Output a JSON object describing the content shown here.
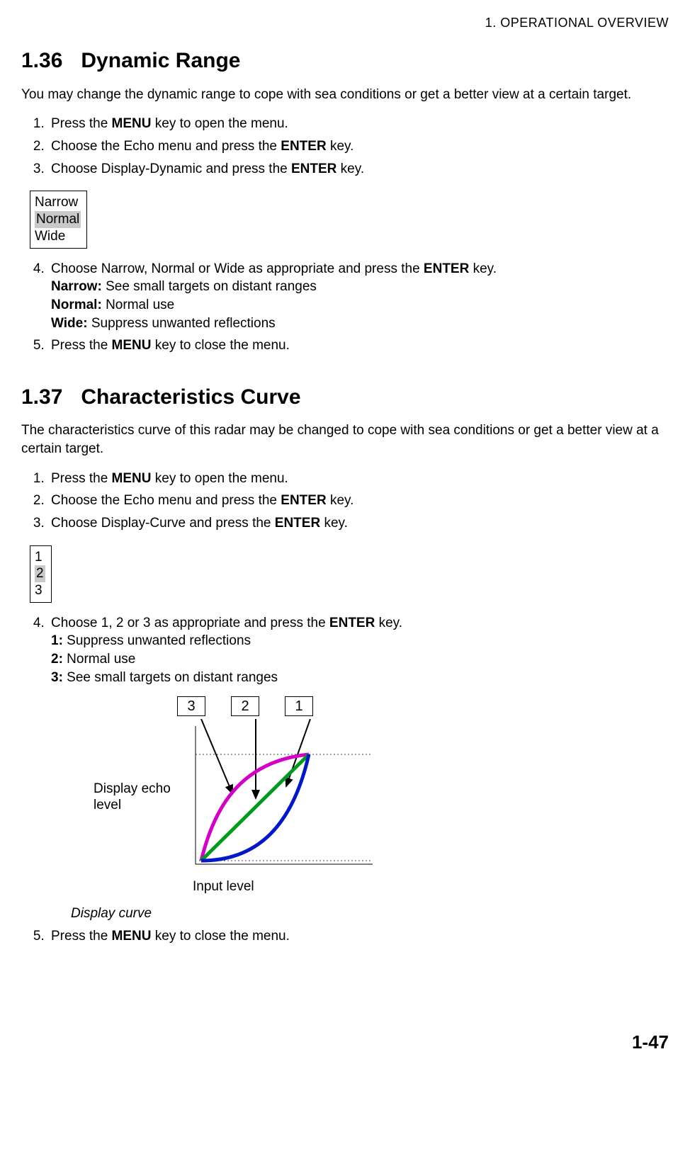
{
  "header": "1. OPERATIONAL OVERVIEW",
  "footer": "1-47",
  "section1": {
    "num": "1.36",
    "title": "Dynamic Range",
    "intro": "You may change the dynamic range to cope with sea conditions or get a better view at a certain target.",
    "steps": {
      "s1a": "Press the ",
      "s1b": "MENU",
      "s1c": " key to open the menu.",
      "s2a": "Choose the Echo menu and press the ",
      "s2b": "ENTER",
      "s2c": " key.",
      "s3a": "Choose Display-Dynamic and press the ",
      "s3b": "ENTER",
      "s3c": " key.",
      "box": {
        "o1": "Narrow",
        "o2": "Normal",
        "o3": "Wide"
      },
      "s4a": "Choose Narrow, Normal or Wide as appropriate and press the ",
      "s4b": "ENTER",
      "s4c": " key.",
      "s4d_label": "Narrow:",
      "s4d_text": " See small targets on distant ranges",
      "s4e_label": "Normal:",
      "s4e_text": " Normal use",
      "s4f_label": "Wide:",
      "s4f_text": " Suppress unwanted reflections",
      "s5a": "Press the ",
      "s5b": "MENU",
      "s5c": " key to close the menu."
    }
  },
  "section2": {
    "num": "1.37",
    "title": "Characteristics Curve",
    "intro": "The characteristics curve of this radar may be changed to cope with sea conditions or get a better view at a certain target.",
    "steps": {
      "s1a": "Press the ",
      "s1b": "MENU",
      "s1c": " key to open the menu.",
      "s2a": "Choose the Echo menu and press the ",
      "s2b": "ENTER",
      "s2c": " key.",
      "s3a": "Choose Display-Curve and press the ",
      "s3b": "ENTER",
      "s3c": " key.",
      "box": {
        "o1": "1",
        "o2": "2",
        "o3": "3"
      },
      "s4a": "Choose 1, 2 or 3 as appropriate and press the ",
      "s4b": "ENTER",
      "s4c": " key.",
      "s4d_label": "1:",
      "s4d_text": " Suppress unwanted reflections",
      "s4e_label": "2:",
      "s4e_text": " Normal use",
      "s4f_label": "3:",
      "s4f_text": " See small targets on distant ranges",
      "s5a": "Press the ",
      "s5b": "MENU",
      "s5c": " key to close the menu."
    },
    "figure": {
      "labels": {
        "l1": "3",
        "l2": "2",
        "l3": "1"
      },
      "ylabel": "Display echo level",
      "xlabel": "Input level",
      "caption": "Display curve"
    }
  },
  "chart_data": {
    "type": "line",
    "title": "Display curve",
    "xlabel": "Input level",
    "ylabel": "Display echo level",
    "xlim": [
      0,
      1
    ],
    "ylim": [
      0,
      1
    ],
    "series": [
      {
        "name": "1",
        "color": "#0017ca",
        "x": [
          0,
          0.3,
          0.5,
          0.72,
          0.85,
          0.97
        ],
        "y": [
          0,
          0.06,
          0.16,
          0.46,
          0.72,
          0.92
        ]
      },
      {
        "name": "2",
        "color": "#009a1d",
        "x": [
          0,
          0.25,
          0.5,
          0.75,
          0.97
        ],
        "y": [
          0,
          0.23,
          0.46,
          0.7,
          0.92
        ]
      },
      {
        "name": "3",
        "color": "#d400c8",
        "x": [
          0,
          0.12,
          0.28,
          0.5,
          0.75,
          0.97
        ],
        "y": [
          0,
          0.24,
          0.55,
          0.82,
          0.91,
          0.92
        ]
      }
    ],
    "annotations": [
      {
        "text": "3",
        "points_to_series": "3"
      },
      {
        "text": "2",
        "points_to_series": "2"
      },
      {
        "text": "1",
        "points_to_series": "1"
      }
    ]
  }
}
